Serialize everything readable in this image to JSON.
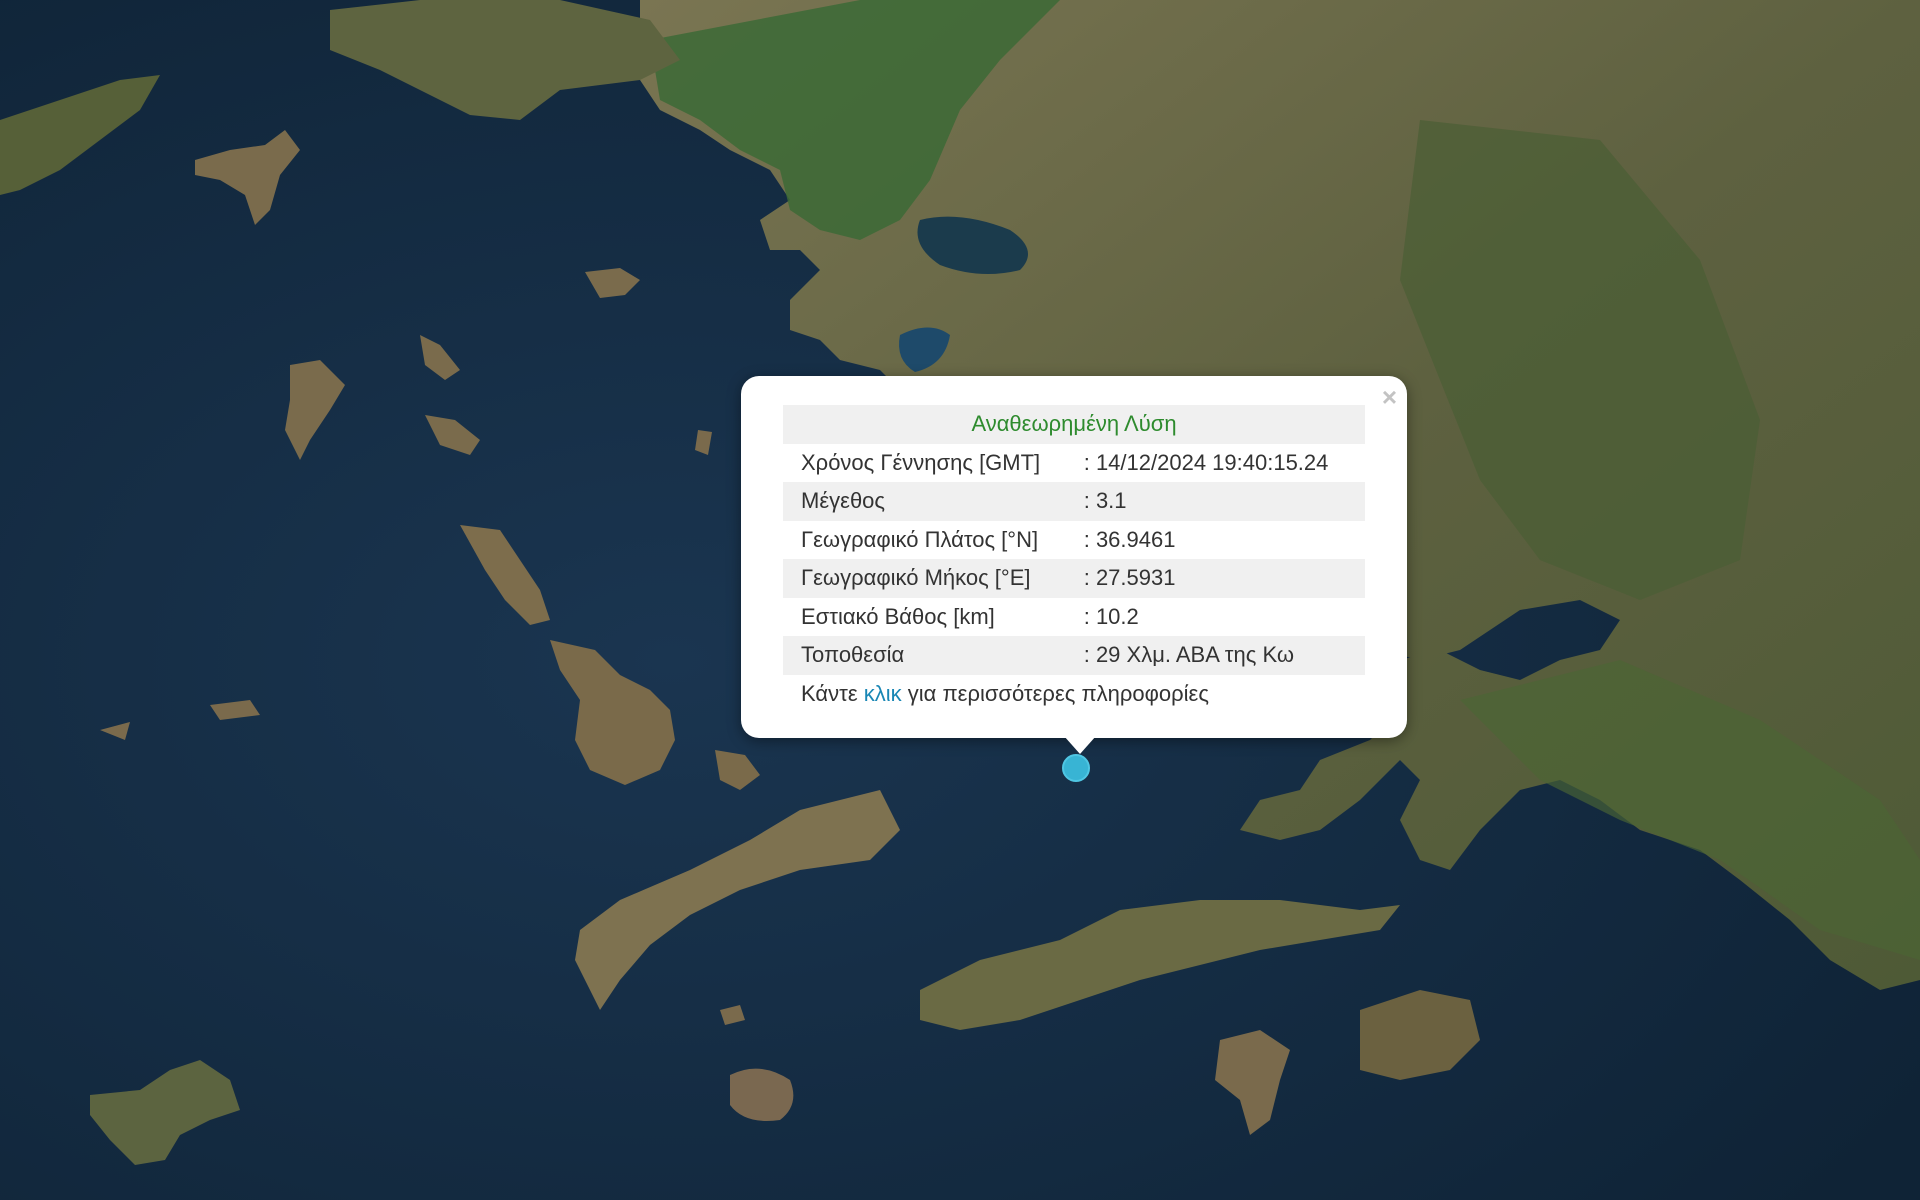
{
  "popup": {
    "title": "Αναθεωρημένη Λύση",
    "close_glyph": "×",
    "rows": [
      {
        "label": "Χρόνος Γέννησης [GMT]",
        "value": ": 14/12/2024 19:40:15.24"
      },
      {
        "label": "Μέγεθος",
        "value": ": 3.1"
      },
      {
        "label": "Γεωγραφικό Πλάτος [°N]",
        "value": ": 36.9461"
      },
      {
        "label": "Γεωγραφικό Μήκος [°E]",
        "value": ": 27.5931"
      },
      {
        "label": "Εστιακό Βάθος [km]",
        "value": ": 10.2"
      },
      {
        "label": "Τοποθεσία",
        "value": ": 29 Χλμ. ΑΒΑ της Κω"
      }
    ],
    "more_prefix": "Κάντε ",
    "more_link": "κλικ",
    "more_suffix": " για περισσότερες πληροφορίες"
  },
  "colors": {
    "sea": "#12283c",
    "land": "#6b6a45",
    "forest": "#3c6a36",
    "title_green": "#2e8b2e",
    "link_blue": "#1a87b5",
    "marker": "#38b4d4"
  }
}
